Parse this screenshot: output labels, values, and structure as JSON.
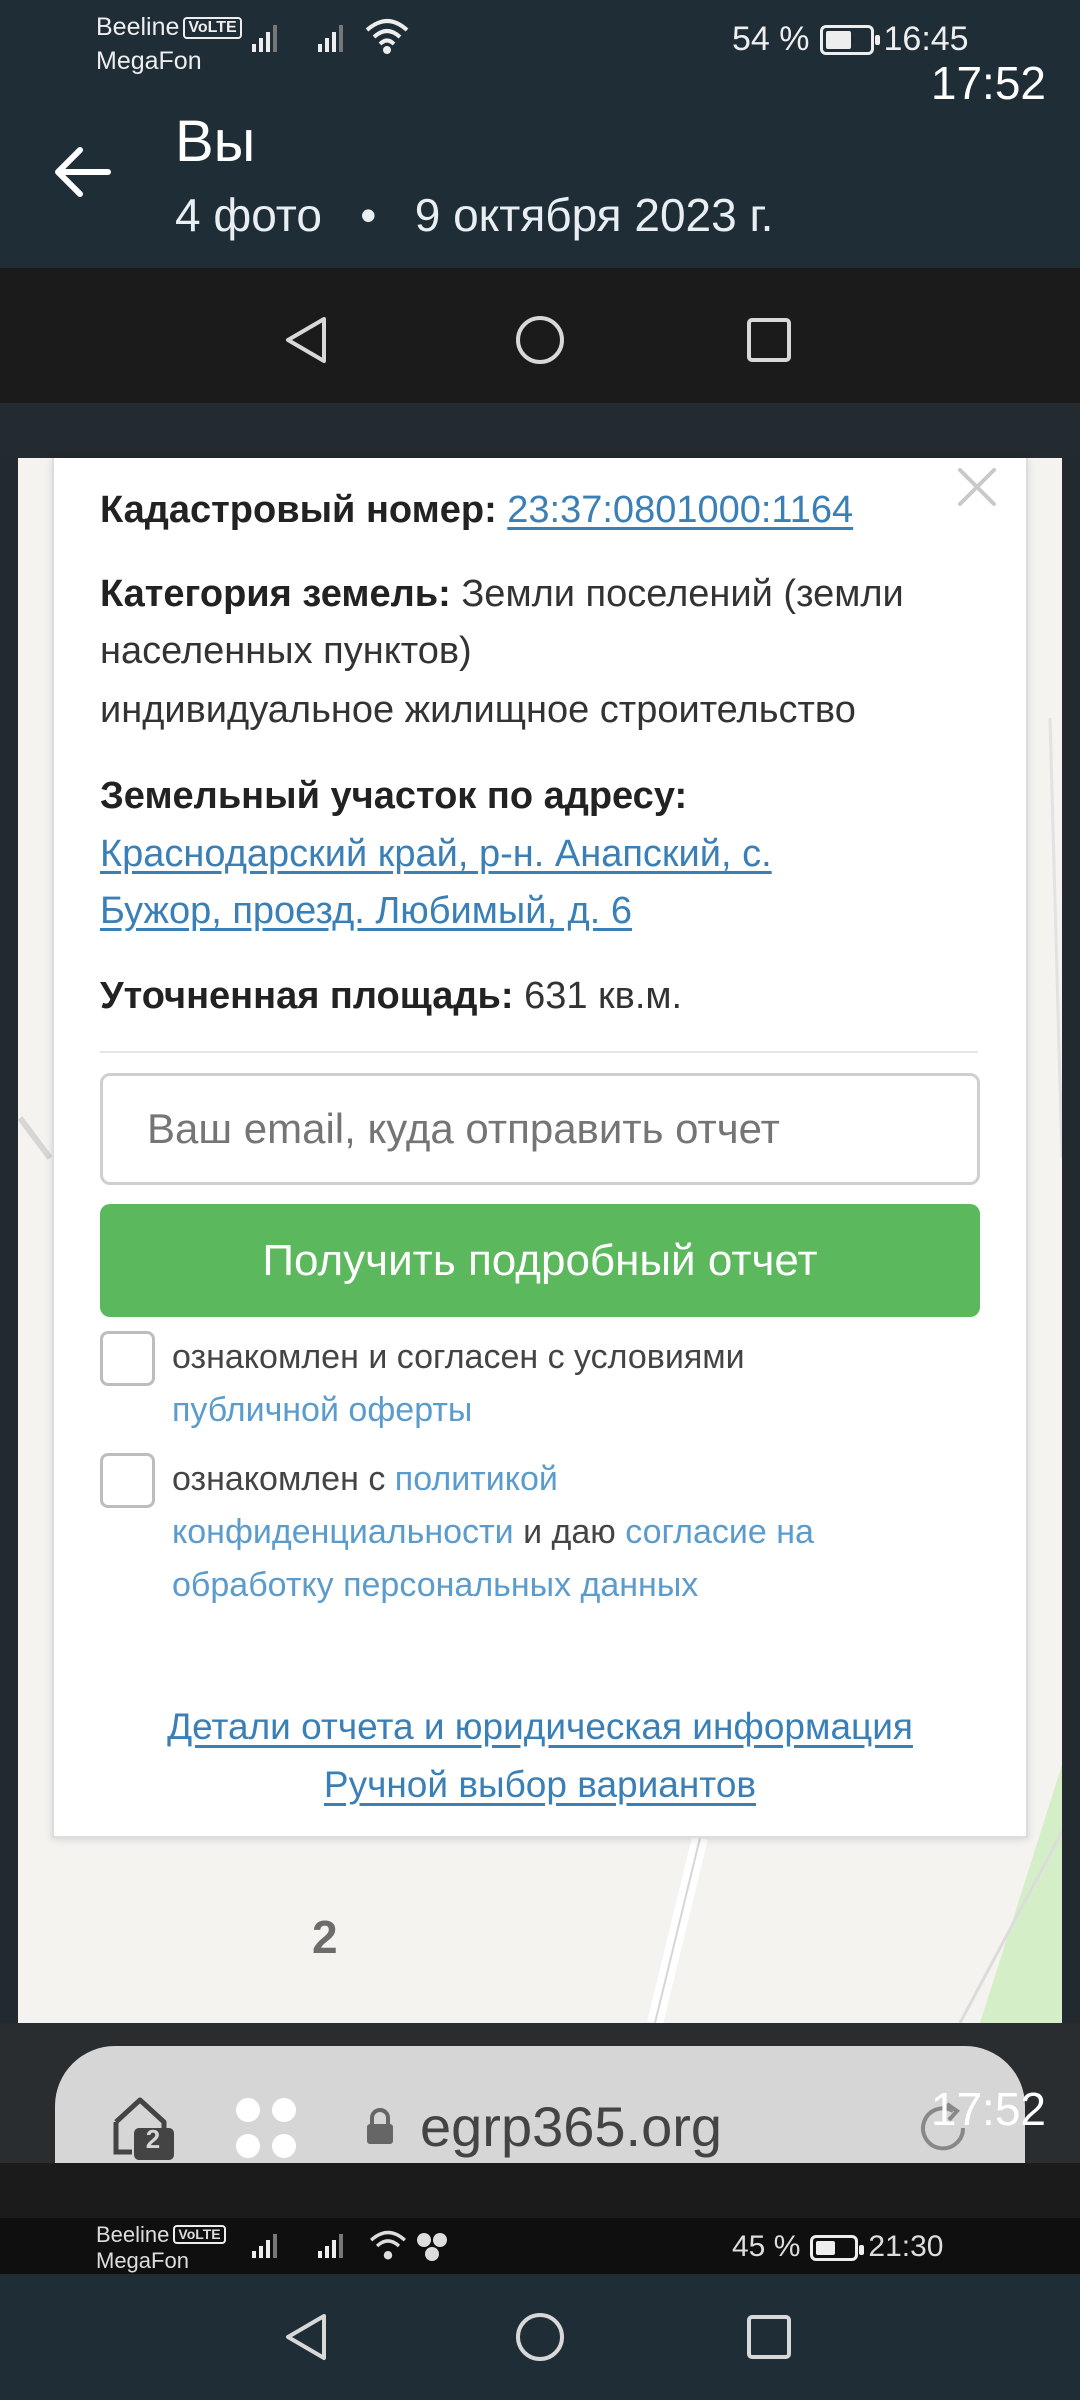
{
  "status_bar": {
    "carrier1": "Beeline",
    "carrier2": "MegaFon",
    "volte": "VoLTE",
    "battery": "54 %",
    "battery_level": 0.54,
    "time": "16:45"
  },
  "header": {
    "title": "Вы",
    "subtitle": "4 фото   •   9 октября 2023 г."
  },
  "embedded_nav": {
    "time": "17:52"
  },
  "card": {
    "cadastral_label": "Кадастровый номер:",
    "cadastral_number": "23:37:0801000:1164",
    "category_label": "Категория земель:",
    "category_value": "Земли поселений (земли населенных пунктов)",
    "usage": "индивидуальное жилищное строительство",
    "address_label": "Земельный участок по адресу:",
    "address_line1": "Краснодарский край, р-н. Анапский, с.",
    "address_line2": "Бужор, проезд. Любимый, д. 6",
    "area_label": "Уточненная площадь:",
    "area_value": "631 кв.м.",
    "email_placeholder": "Ваш email, куда отправить отчет",
    "report_button": "Получить подробный отчет",
    "consent1_text": "ознакомлен и согласен с условиями",
    "consent1_link": "публичной оферты",
    "consent2_text_a": "ознакомлен с",
    "consent2_link_a": "политикой",
    "consent2_link_b": "конфиденциальности",
    "consent2_text_b": "и даю",
    "consent2_link_c": "согласие на",
    "consent2_link_d": "обработку персональных данных",
    "footer_link1": "Детали отчета и юридическая информация",
    "footer_link2": "Ручной выбор вариантов"
  },
  "map": {
    "label": "2"
  },
  "browser": {
    "url": "egrp365.org",
    "tab_count": "2",
    "time": "17:52"
  },
  "status_bar2": {
    "carrier1": "Beeline",
    "carrier2": "MegaFon",
    "volte": "VoLTE",
    "battery": "45 %",
    "battery_level": 0.45,
    "time": "21:30"
  }
}
